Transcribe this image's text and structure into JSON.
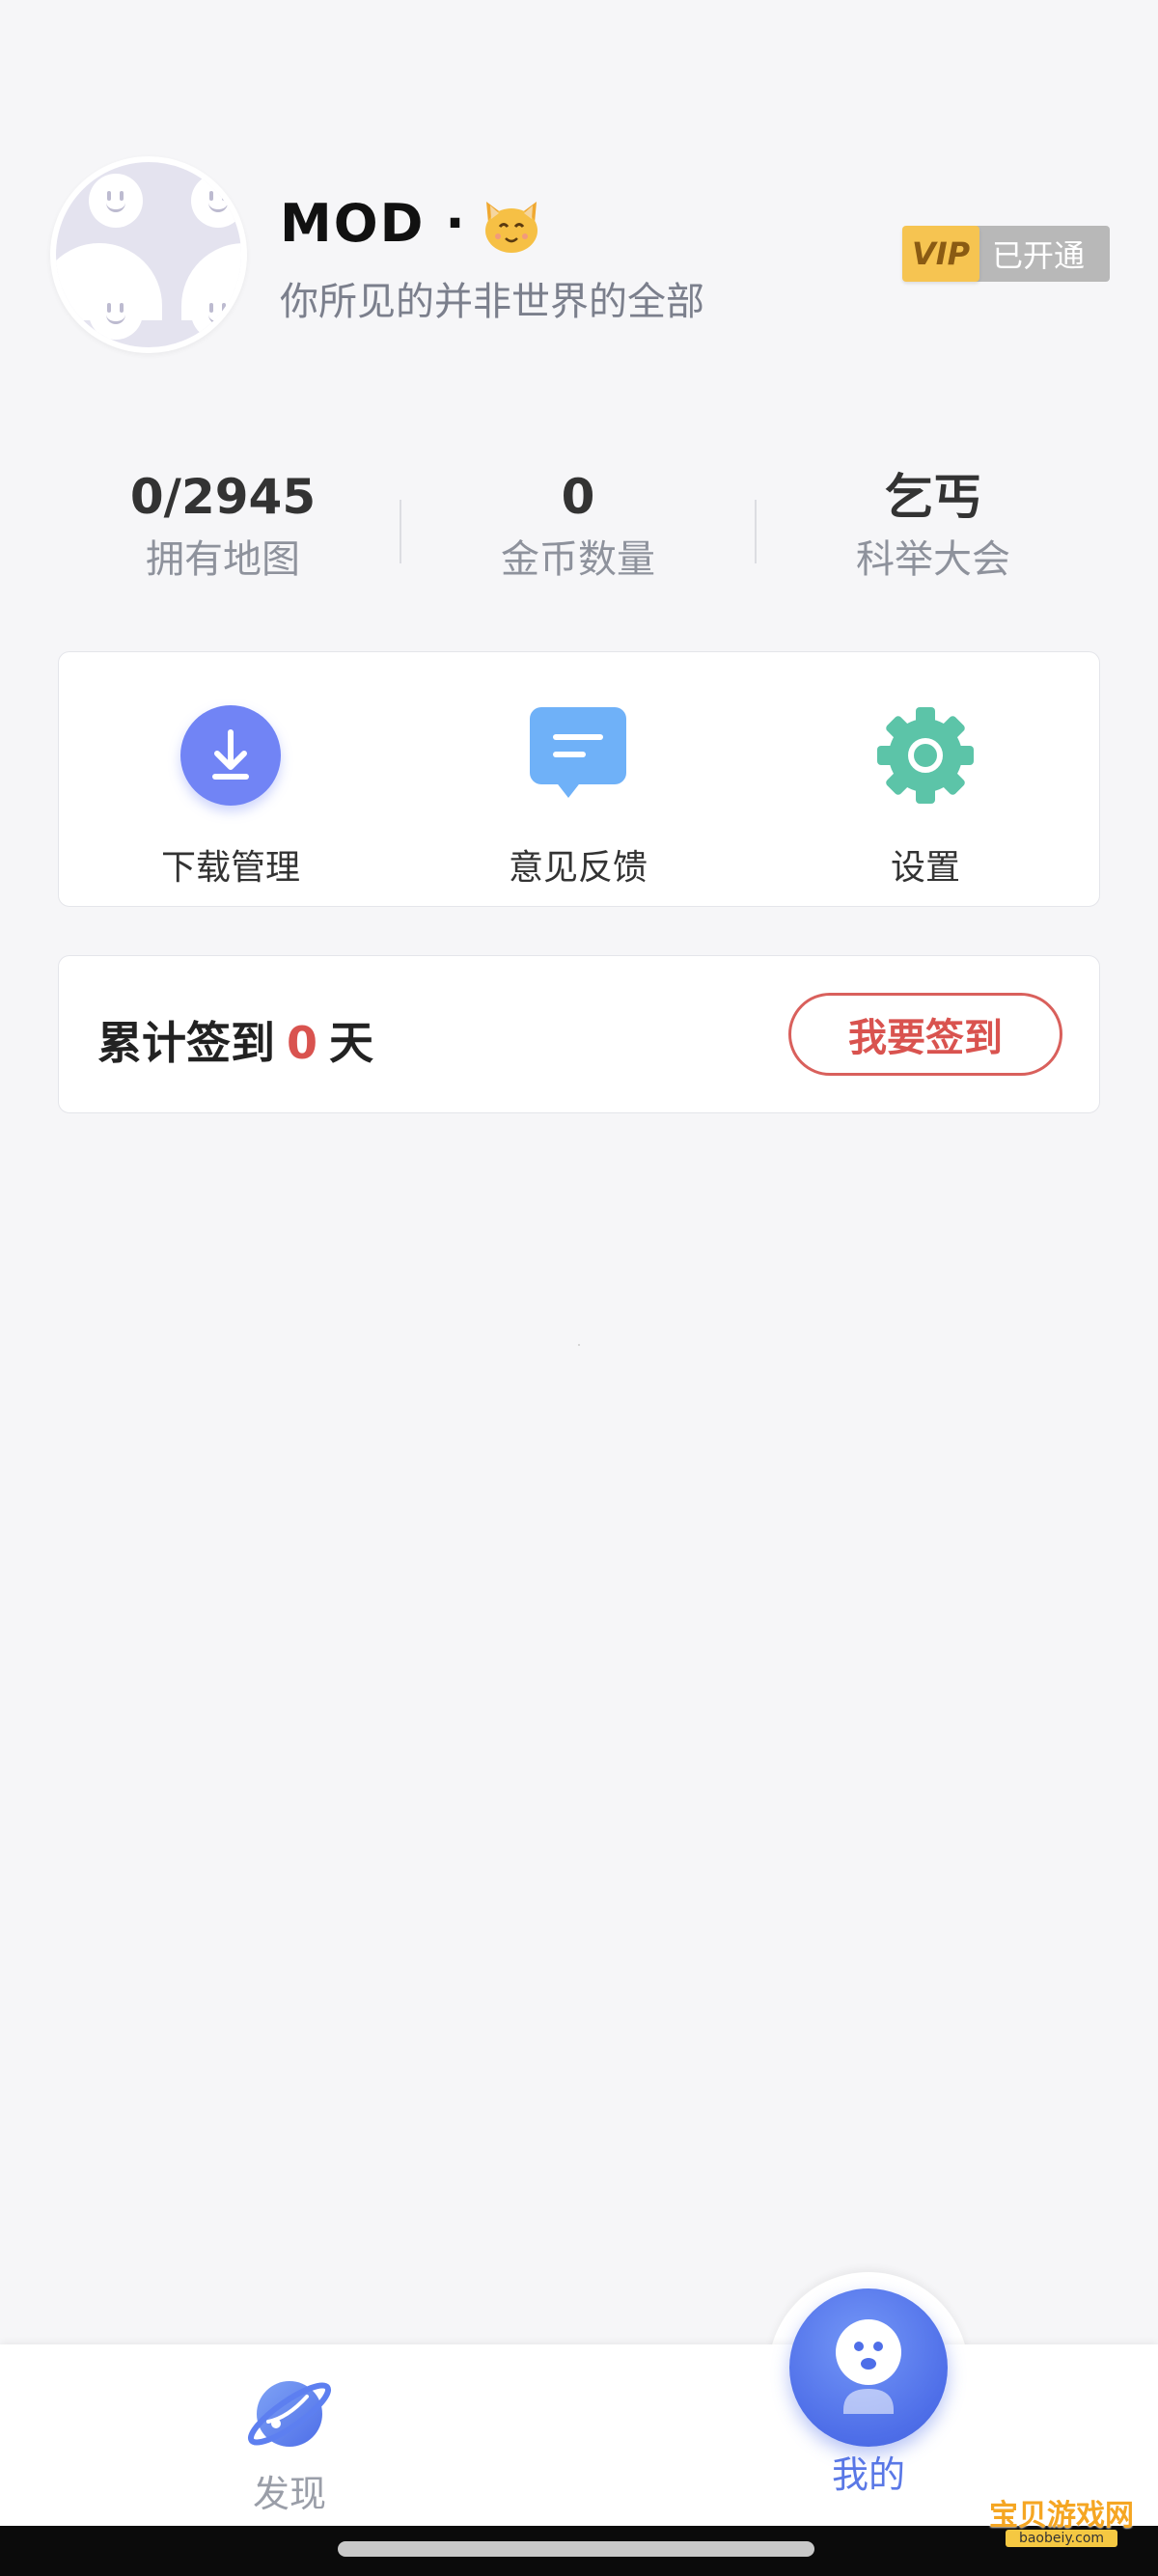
{
  "profile": {
    "name": "MOD ·",
    "motto": "你所见的并非世界的全部",
    "vip_tag": "VIP",
    "vip_status": "已开通"
  },
  "stats": [
    {
      "value": "0/2945",
      "label": "拥有地图"
    },
    {
      "value": "0",
      "label": "金币数量"
    },
    {
      "value": "乞丐",
      "label": "科举大会"
    }
  ],
  "shortcuts": [
    {
      "label": "下载管理",
      "icon": "download-icon"
    },
    {
      "label": "意见反馈",
      "icon": "feedback-icon"
    },
    {
      "label": "设置",
      "icon": "gear-icon"
    }
  ],
  "checkin": {
    "prefix": "累计签到",
    "days": "0",
    "suffix": "天",
    "button_label": "我要签到"
  },
  "tabbar": {
    "discover_label": "发现",
    "mine_label": "我的"
  },
  "watermark": {
    "text": "宝贝游戏网",
    "sub": "baobeiy.com"
  },
  "colors": {
    "accent_red": "#d9534f",
    "tab_active": "#5a78e6",
    "download_icon_bg": "#7184f5",
    "feedback_icon_bg": "#6fb1f8",
    "settings_icon_bg": "#5cc4a8",
    "vip_gold": "#f6c451"
  }
}
